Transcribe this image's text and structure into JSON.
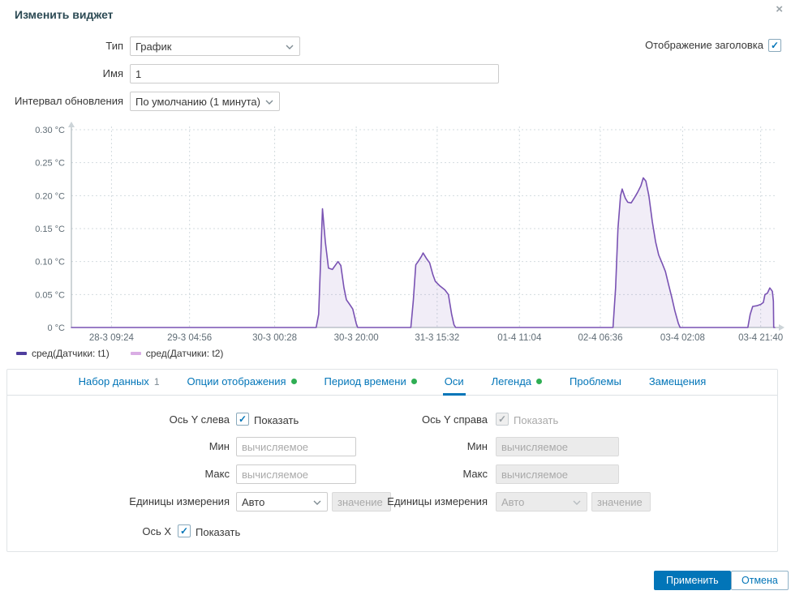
{
  "dialog": {
    "title": "Изменить виджет",
    "close_glyph": "×"
  },
  "form": {
    "type_label": "Тип",
    "type_value": "График",
    "show_header_label": "Отображение заголовка",
    "name_label": "Имя",
    "name_value": "1",
    "refresh_label": "Интервал обновления",
    "refresh_value": "По умолчанию (1 минута)"
  },
  "chart_data": {
    "type": "area",
    "title": "",
    "ylabel": "°C",
    "ylim": [
      0,
      0.3
    ],
    "grid": true,
    "legend_position": "bottom-left",
    "y_ticks": [
      {
        "label": "0.30 °C",
        "value": 0.3
      },
      {
        "label": "0.25 °C",
        "value": 0.25
      },
      {
        "label": "0.20 °C",
        "value": 0.2
      },
      {
        "label": "0.15 °C",
        "value": 0.15
      },
      {
        "label": "0.10 °C",
        "value": 0.1
      },
      {
        "label": "0.05 °C",
        "value": 0.05
      },
      {
        "label": "0 °C",
        "value": 0
      }
    ],
    "x_ticks": [
      {
        "label": "28-3 09:24",
        "f": 0.057
      },
      {
        "label": "29-3 04:56",
        "f": 0.168
      },
      {
        "label": "30-3 00:28",
        "f": 0.289
      },
      {
        "label": "30-3 20:00",
        "f": 0.405
      },
      {
        "label": "31-3 15:32",
        "f": 0.52
      },
      {
        "label": "01-4 11:04",
        "f": 0.637
      },
      {
        "label": "02-4 06:36",
        "f": 0.752
      },
      {
        "label": "03-4 02:08",
        "f": 0.869
      },
      {
        "label": "03-4 21:40",
        "f": 0.98
      }
    ],
    "series": [
      {
        "name": "сред(Датчики: t1)",
        "color": "#7952b3",
        "fill": "rgba(121,82,179,0.10)",
        "points": [
          [
            0.0,
            0
          ],
          [
            0.348,
            0
          ],
          [
            0.3515,
            0.02
          ],
          [
            0.357,
            0.18
          ],
          [
            0.361,
            0.13
          ],
          [
            0.3655,
            0.09
          ],
          [
            0.371,
            0.088
          ],
          [
            0.379,
            0.1
          ],
          [
            0.383,
            0.094
          ],
          [
            0.3875,
            0.06
          ],
          [
            0.391,
            0.042
          ],
          [
            0.3956,
            0.035
          ],
          [
            0.4,
            0.028
          ],
          [
            0.405,
            0.006
          ],
          [
            0.407,
            0
          ],
          [
            0.4826,
            0
          ],
          [
            0.486,
            0.04
          ],
          [
            0.4896,
            0.095
          ],
          [
            0.493,
            0.1
          ],
          [
            0.4977,
            0.108
          ],
          [
            0.5,
            0.113
          ],
          [
            0.5046,
            0.105
          ],
          [
            0.5093,
            0.098
          ],
          [
            0.514,
            0.08
          ],
          [
            0.5174,
            0.07
          ],
          [
            0.524,
            0.063
          ],
          [
            0.531,
            0.057
          ],
          [
            0.536,
            0.05
          ],
          [
            0.5406,
            0.02
          ],
          [
            0.544,
            0.004
          ],
          [
            0.5464,
            0
          ],
          [
            0.77,
            0
          ],
          [
            0.7737,
            0.06
          ],
          [
            0.777,
            0.15
          ],
          [
            0.7807,
            0.2
          ],
          [
            0.783,
            0.21
          ],
          [
            0.7876,
            0.196
          ],
          [
            0.791,
            0.19
          ],
          [
            0.7958,
            0.189
          ],
          [
            0.8,
            0.196
          ],
          [
            0.805,
            0.205
          ],
          [
            0.8097,
            0.215
          ],
          [
            0.813,
            0.227
          ],
          [
            0.8167,
            0.222
          ],
          [
            0.821,
            0.2
          ],
          [
            0.826,
            0.16
          ],
          [
            0.8306,
            0.13
          ],
          [
            0.835,
            0.11
          ],
          [
            0.84,
            0.097
          ],
          [
            0.8445,
            0.085
          ],
          [
            0.849,
            0.065
          ],
          [
            0.8538,
            0.045
          ],
          [
            0.858,
            0.025
          ],
          [
            0.863,
            0.006
          ],
          [
            0.8654,
            0
          ],
          [
            0.9617,
            0
          ],
          [
            0.965,
            0.02
          ],
          [
            0.9686,
            0.032
          ],
          [
            0.9744,
            0.033
          ],
          [
            0.98,
            0.035
          ],
          [
            0.9837,
            0.038
          ],
          [
            0.986,
            0.05
          ],
          [
            0.9895,
            0.052
          ],
          [
            0.993,
            0.06
          ],
          [
            0.9965,
            0.055
          ],
          [
            0.998,
            0.04
          ],
          [
            0.9985,
            0
          ],
          [
            1.0,
            0
          ]
        ]
      },
      {
        "name": "сред(Датчики: t2)",
        "color": "#d9ade4",
        "points": []
      }
    ],
    "legend": [
      {
        "label": "сред(Датчики: t1)",
        "color": "#4f3e9e"
      },
      {
        "label": "сред(Датчики: t2)",
        "color": "#d9ade4"
      }
    ]
  },
  "tabs": [
    {
      "label": "Набор данных",
      "badge": "1"
    },
    {
      "label": "Опции отображения",
      "dot": true
    },
    {
      "label": "Период времени",
      "dot": true
    },
    {
      "label": "Оси",
      "active": true
    },
    {
      "label": "Легенда",
      "dot": true
    },
    {
      "label": "Проблемы"
    },
    {
      "label": "Замещения"
    }
  ],
  "axes": {
    "left": {
      "axis_label": "Ось Y слева",
      "show_label": "Показать",
      "min_label": "Мин",
      "max_label": "Макс",
      "units_label": "Единицы измерения",
      "units_value": "Авто",
      "min_placeholder": "вычисляемое",
      "max_placeholder": "вычисляемое",
      "units_value_placeholder": "значение"
    },
    "right": {
      "axis_label": "Ось Y справа",
      "show_label": "Показать",
      "min_label": "Мин",
      "max_label": "Макс",
      "units_label": "Единицы измерения",
      "units_value": "Авто",
      "min_placeholder": "вычисляемое",
      "max_placeholder": "вычисляемое",
      "units_value_placeholder": "значение"
    },
    "x": {
      "axis_label": "Ось X",
      "show_label": "Показать"
    }
  },
  "footer": {
    "apply_label": "Применить",
    "cancel_label": "Отмена"
  }
}
